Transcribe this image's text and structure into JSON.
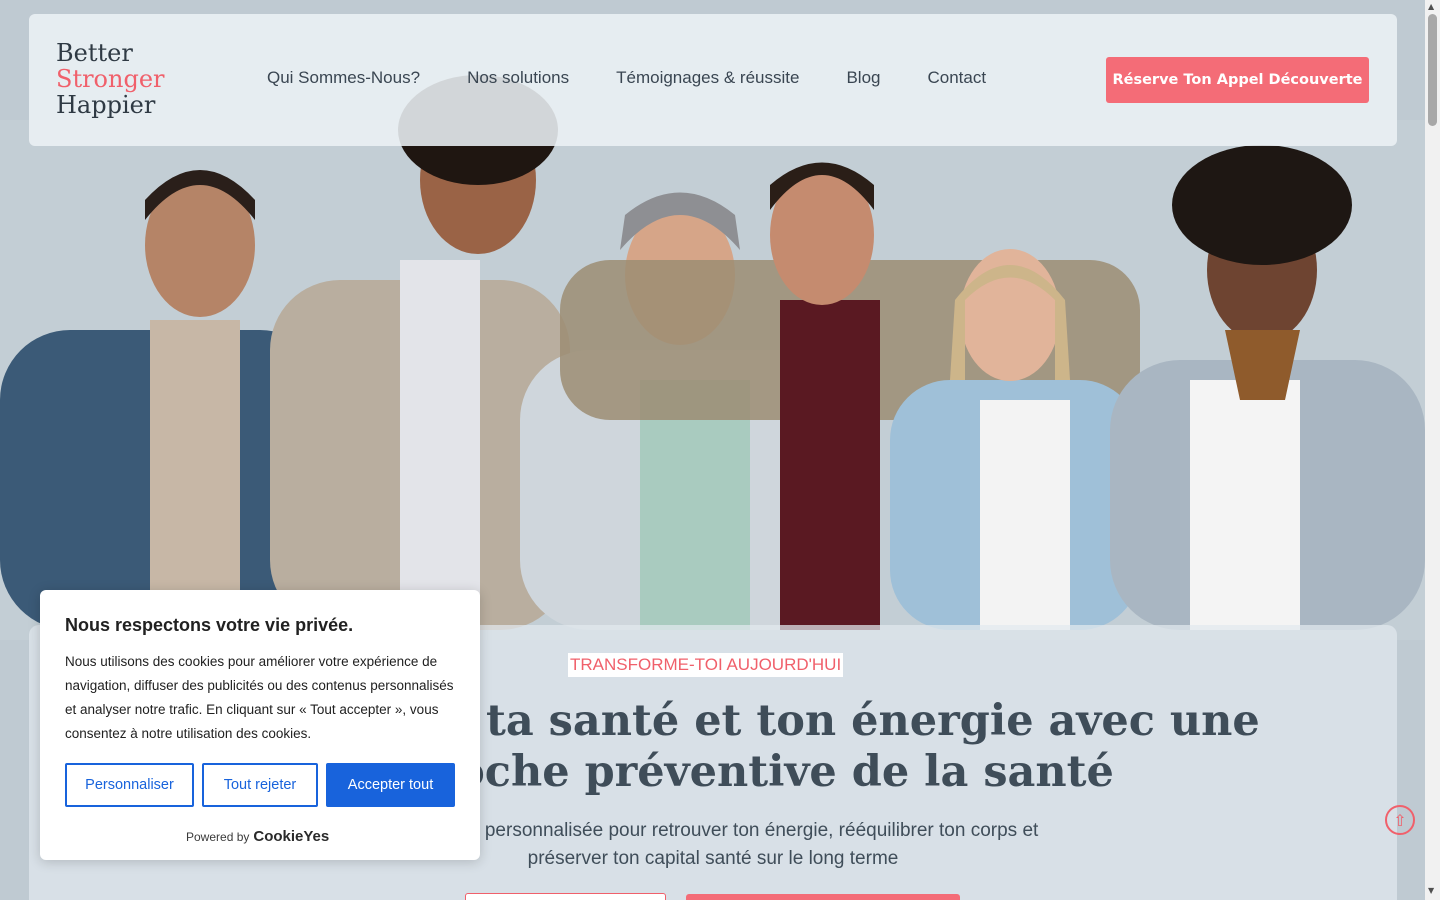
{
  "colors": {
    "accent": "#f46c77",
    "text_dark": "#3f4d59",
    "cookie_blue": "#1863dc"
  },
  "logo": {
    "line1": "Better",
    "line2": "Stronger",
    "line3": "Happier"
  },
  "nav": {
    "items": [
      {
        "label": "Qui Sommes-Nous?"
      },
      {
        "label": "Nos solutions"
      },
      {
        "label": "Témoignages & réussite"
      },
      {
        "label": "Blog"
      },
      {
        "label": "Contact"
      }
    ],
    "cta_label": "Réserve Ton Appel Découverte"
  },
  "hero": {
    "eyebrow": "TRANSFORME-TOI AUJOURD'HUI",
    "headline": "oir sur ta santé et ton énergie avec une oche préventive de la santé",
    "headline_line1": "oir sur ta santé et ton énergie avec une",
    "headline_line2": "oche préventive de la santé",
    "subtitle_line1": "éventive et personnalisée pour retrouver ton énergie, rééquilibrer ton corps et",
    "subtitle_line2": "préserver ton capital santé sur le long terme"
  },
  "cookie": {
    "title": "Nous respectons votre vie privée.",
    "text": "Nous utilisons des cookies pour améliorer votre expérience de navigation, diffuser des publicités ou des contenus personnalisés et analyser notre trafic. En cliquant sur « Tout accepter », vous consentez à notre utilisation des cookies.",
    "customize_label": "Personnaliser",
    "reject_label": "Tout rejeter",
    "accept_label": "Accepter tout",
    "powered_by": "Powered by",
    "brand": "CookieYes"
  },
  "icons": {
    "scroll_top": "arrow-up-circle-icon"
  }
}
